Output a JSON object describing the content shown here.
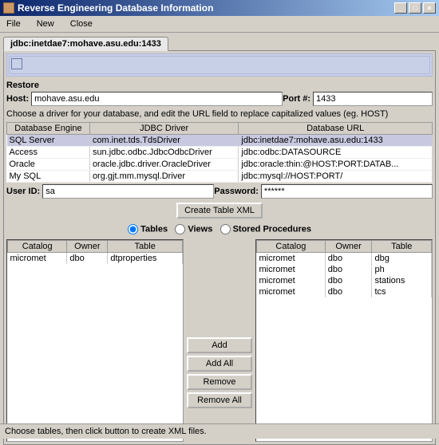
{
  "window": {
    "title": "Reverse Engineering Database Information"
  },
  "menu": {
    "file": "File",
    "new": "New",
    "close": "Close"
  },
  "tab": {
    "label": "jdbc:inetdae7:mohave.asu.edu:1433"
  },
  "panel": {
    "restore": "Restore",
    "host_lbl": "Host:",
    "host_val": "mohave.asu.edu",
    "port_lbl": "Port #:",
    "port_val": "1433",
    "helper": "Choose a driver for your database, and edit the URL field to replace capitalized values (eg. HOST)"
  },
  "drivers": {
    "headers": [
      "Database Engine",
      "JDBC Driver",
      "Database URL"
    ],
    "rows": [
      {
        "engine": "SQL Server",
        "driver": "com.inet.tds.TdsDriver",
        "url": "jdbc:inetdae7:mohave.asu.edu:1433",
        "selected": true
      },
      {
        "engine": "Access",
        "driver": "sun.jdbc.odbc.JdbcOdbcDriver",
        "url": "jdbc:odbc:DATASOURCE",
        "selected": false
      },
      {
        "engine": "Oracle",
        "driver": "oracle.jdbc.driver.OracleDriver",
        "url": "jdbc:oracle:thin:@HOST:PORT:DATAB...",
        "selected": false
      },
      {
        "engine": "My SQL",
        "driver": "org.gjt.mm.mysql.Driver",
        "url": "jdbc:mysql://HOST:PORT/",
        "selected": false
      }
    ]
  },
  "auth": {
    "user_lbl": "User ID:",
    "user_val": "sa",
    "pass_lbl": "Password:",
    "pass_val": "******"
  },
  "buttons": {
    "create_xml": "Create Table XML",
    "add": "Add",
    "add_all": "Add All",
    "remove": "Remove",
    "remove_all": "Remove All"
  },
  "radios": {
    "tables": "Tables",
    "views": "Views",
    "sprocs": "Stored Procedures",
    "selected": "tables"
  },
  "table_headers": [
    "Catalog",
    "Owner",
    "Table"
  ],
  "left_list": [
    {
      "catalog": "micromet",
      "owner": "dbo",
      "table": "dtproperties"
    }
  ],
  "right_list": [
    {
      "catalog": "micromet",
      "owner": "dbo",
      "table": "dbg"
    },
    {
      "catalog": "micromet",
      "owner": "dbo",
      "table": "ph"
    },
    {
      "catalog": "micromet",
      "owner": "dbo",
      "table": "stations"
    },
    {
      "catalog": "micromet",
      "owner": "dbo",
      "table": "tcs"
    }
  ],
  "status": "Choose tables, then click button to create XML files."
}
